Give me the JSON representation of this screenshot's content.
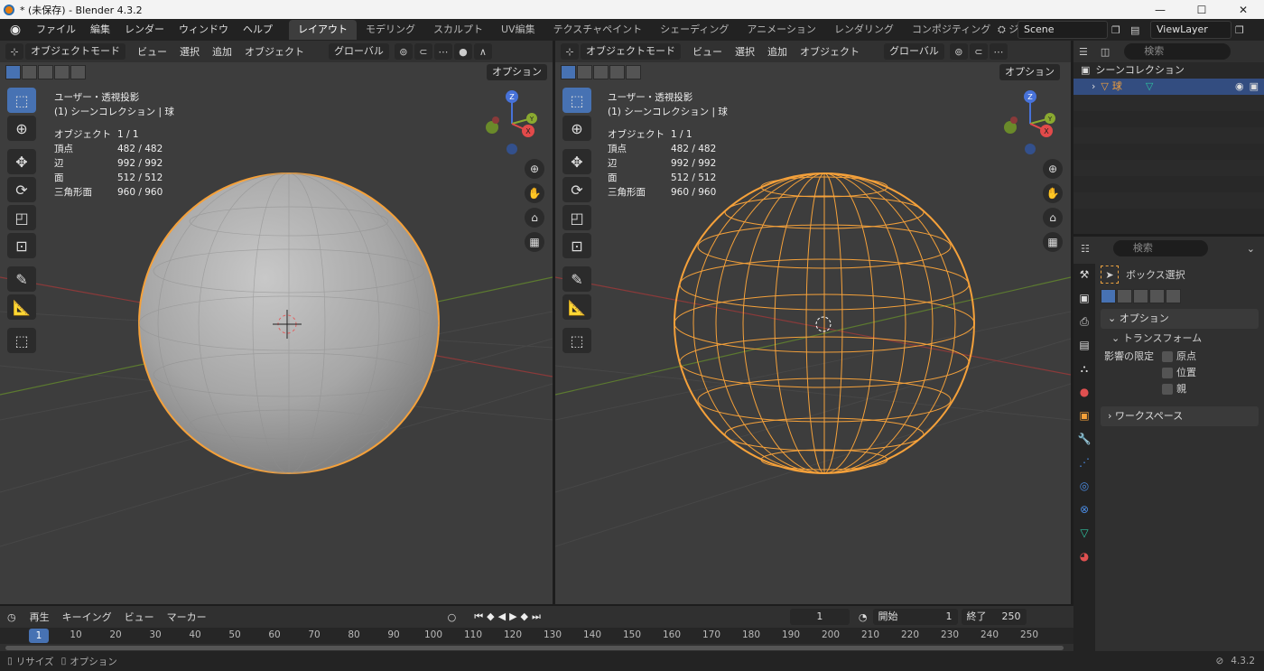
{
  "window": {
    "title": "* (未保存) - Blender 4.3.2",
    "min": "—",
    "max": "☐",
    "close": "✕"
  },
  "menus": [
    "ファイル",
    "編集",
    "レンダー",
    "ウィンドウ",
    "ヘルプ"
  ],
  "workspaces": [
    "レイアウト",
    "モデリング",
    "スカルプト",
    "UV編集",
    "テクスチャペイント",
    "シェーディング",
    "アニメーション",
    "レンダリング",
    "コンポジティング",
    "ジオメトリノ"
  ],
  "scene": "Scene",
  "view_layer": "ViewLayer",
  "viewport_header": {
    "mode": "オブジェクトモード",
    "menu": [
      "ビュー",
      "選択",
      "追加",
      "オブジェクト"
    ],
    "transform": "グローバル",
    "options": "オプション"
  },
  "viewport_info": {
    "view": "ユーザー・透視投影",
    "collection": "(1) シーンコレクション | 球",
    "stats": [
      {
        "k": "オブジェクト",
        "v": "1 / 1"
      },
      {
        "k": "頂点",
        "v": "482 / 482"
      },
      {
        "k": "辺",
        "v": "992 / 992"
      },
      {
        "k": "面",
        "v": "512 / 512"
      },
      {
        "k": "三角形面",
        "v": "960 / 960"
      }
    ]
  },
  "axis": {
    "x": "X",
    "y": "Y",
    "z": "Z"
  },
  "outliner": {
    "search_placeholder": "検索",
    "root": "シーンコレクション",
    "object": "球"
  },
  "properties": {
    "search_placeholder": "検索",
    "tool": "ボックス選択",
    "options_panel": "オプション",
    "transform_panel": "トランスフォーム",
    "affect_label": "影響の限定",
    "affect": [
      "原点",
      "位置",
      "親"
    ],
    "workspace_panel": "ワークスペース"
  },
  "timeline": {
    "menu": [
      "再生",
      "キーイング",
      "ビュー",
      "マーカー"
    ],
    "current_frame": "1",
    "start_label": "開始",
    "start": "1",
    "end_label": "終了",
    "end": "250",
    "ticks": [
      "10",
      "20",
      "30",
      "40",
      "50",
      "60",
      "70",
      "80",
      "90",
      "100",
      "110",
      "120",
      "130",
      "140",
      "150",
      "160",
      "170",
      "180",
      "190",
      "200",
      "210",
      "220",
      "230",
      "240",
      "250"
    ],
    "cursor": "1"
  },
  "status": {
    "left1": "リサイズ",
    "left2": "オプション",
    "version": "4.3.2"
  },
  "colors": {
    "accent": "#4772b3",
    "selection": "#f5a13a",
    "background": "#3d3d3d"
  }
}
